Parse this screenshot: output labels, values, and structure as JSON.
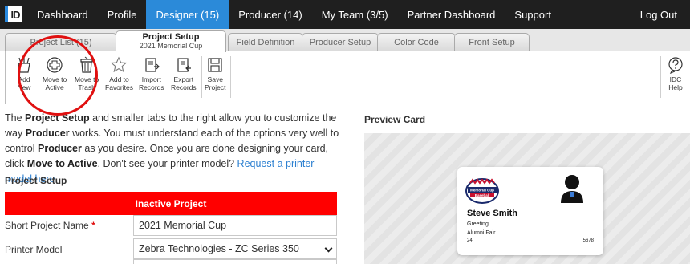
{
  "nav": {
    "logo": "ID",
    "items": [
      "Dashboard",
      "Profile",
      "Designer (15)",
      "Producer (14)",
      "My Team (3/5)",
      "Partner Dashboard",
      "Support"
    ],
    "logout": "Log Out"
  },
  "tabs": {
    "project_list": "Project List (15)",
    "project_setup": "Project Setup",
    "project_setup_sub": "2021 Memorial Cup",
    "field_definition": "Field Definition",
    "producer_setup": "Producer Setup",
    "color_code": "Color Code",
    "front_setup": "Front Setup"
  },
  "toolbar": {
    "add_new": [
      "Add",
      "New"
    ],
    "move_active": [
      "Move to",
      "Active"
    ],
    "move_trash": [
      "Move to",
      "Trash"
    ],
    "add_favorites": [
      "Add to",
      "Favorites"
    ],
    "import_records": [
      "Import",
      "Records"
    ],
    "export_records": [
      "Export",
      "Records"
    ],
    "save_project": [
      "Save",
      "Project"
    ],
    "idc_help": [
      "IDC",
      "Help"
    ]
  },
  "intro": {
    "p1": "The ",
    "b1": "Project Setup",
    "p2": " and smaller tabs to the right allow you to customize the way ",
    "b2": "Producer",
    "p3": " works. You must understand each of the options very well to control ",
    "b3": "Producer",
    "p4": " as you desire. Once you are done designing your card, click ",
    "b4": "Move to Active",
    "p5": ". Don't see your printer model? ",
    "link": "Request a printer model here."
  },
  "form": {
    "section_title": "Project Setup",
    "status_banner": "Inactive Project",
    "short_name_label": "Short Project Name",
    "short_name_required": "*",
    "short_name_value": "2021 Memorial Cup",
    "printer_label": "Printer Model",
    "printer_value": "Zebra Technologies - ZC Series 350"
  },
  "preview": {
    "title": "Preview Card",
    "logo_line1": "Memorial Cup",
    "logo_line2": "Baseball",
    "name": "Steve Smith",
    "line1": "Greeting",
    "line2": "Alumni Fair",
    "left_num": "24",
    "right_num": "5678"
  },
  "colors": {
    "nav_bg": "#1f1f1f",
    "nav_active": "#2b8ad9",
    "banner": "#ff0000",
    "annotation_circle": "#e01010",
    "link": "#2b7fd0"
  }
}
